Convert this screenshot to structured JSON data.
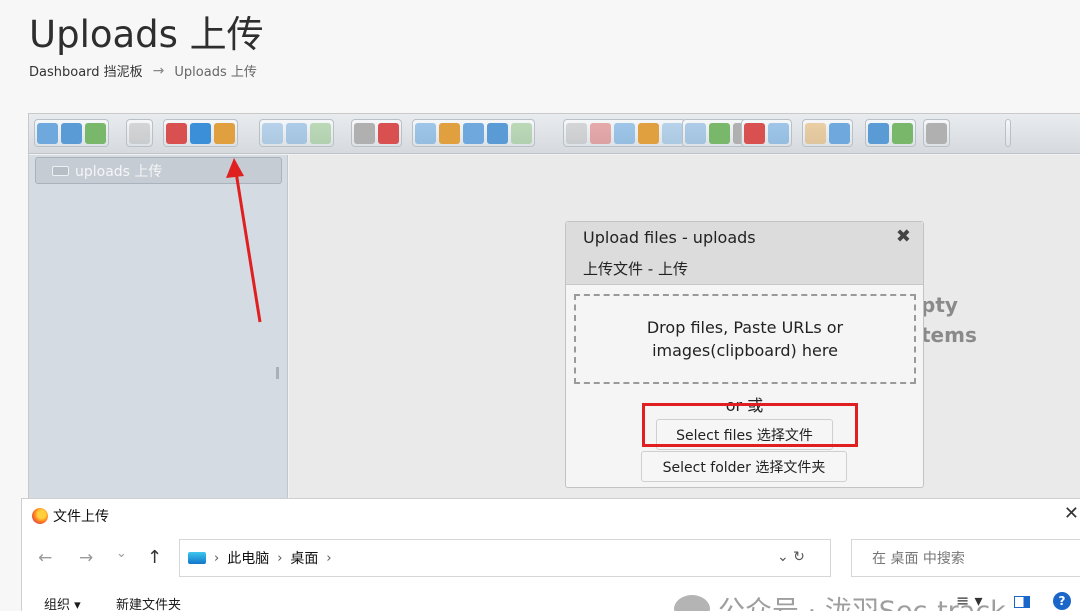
{
  "page": {
    "title": "Uploads  上传",
    "breadcrumb": [
      "Dashboard 挡泥板",
      "Uploads 上传"
    ],
    "breadcrumb_separator": "→"
  },
  "toolbar": {
    "buttons": [
      "back-icon",
      "forward-icon",
      "up-icon",
      "computer-icon",
      "open-icon",
      "new-file-icon",
      "save-icon",
      "preview-icon",
      "save-as-icon",
      "select-icon",
      "undo-icon",
      "redo-icon",
      "copy-icon",
      "cut-icon",
      "paste-icon",
      "delete-icon",
      "empty-icon",
      "duplicate-icon",
      "rename-icon",
      "edit-icon",
      "resize-icon",
      "select-all-icon",
      "select-none-icon",
      "invert-icon",
      "view-icon",
      "info-icon",
      "extract-icon",
      "archive-icon",
      "list-view-icon",
      "details-view-icon",
      "help-icon",
      "fullscreen-icon"
    ]
  },
  "sidebar": {
    "tree_root": "uploads 上传"
  },
  "content": {
    "empty_line_1": "pty",
    "empty_line_2": "tems"
  },
  "upload_dialog": {
    "title": "Upload files - uploads",
    "subtitle": "上传文件 - 上传",
    "close": "✖",
    "drop_text_1": "Drop files, Paste URLs or",
    "drop_text_2": "images(clipboard) here",
    "or_text": "or 或",
    "select_files": "Select files 选择文件",
    "select_folder": "Select folder 选择文件夹"
  },
  "file_dialog": {
    "title": "文件上传",
    "close": "✕",
    "back": "←",
    "forward": "→",
    "recent": "⌄",
    "up": "↑",
    "address": [
      "此电脑",
      "桌面"
    ],
    "address_tools": "⌄  ↻",
    "search_placeholder": "在 桌面 中搜索",
    "watermark": "公众号 · 泷羽Sec-track",
    "organize": "组织 ▾",
    "new_folder": "新建文件夹",
    "view_menu": "≡ ▾",
    "help": "?"
  },
  "colors": {
    "annotation_red": "#e02020",
    "sidebar_bg": "#d5dbe2",
    "toolbar_accent": "#3a8fd8"
  }
}
